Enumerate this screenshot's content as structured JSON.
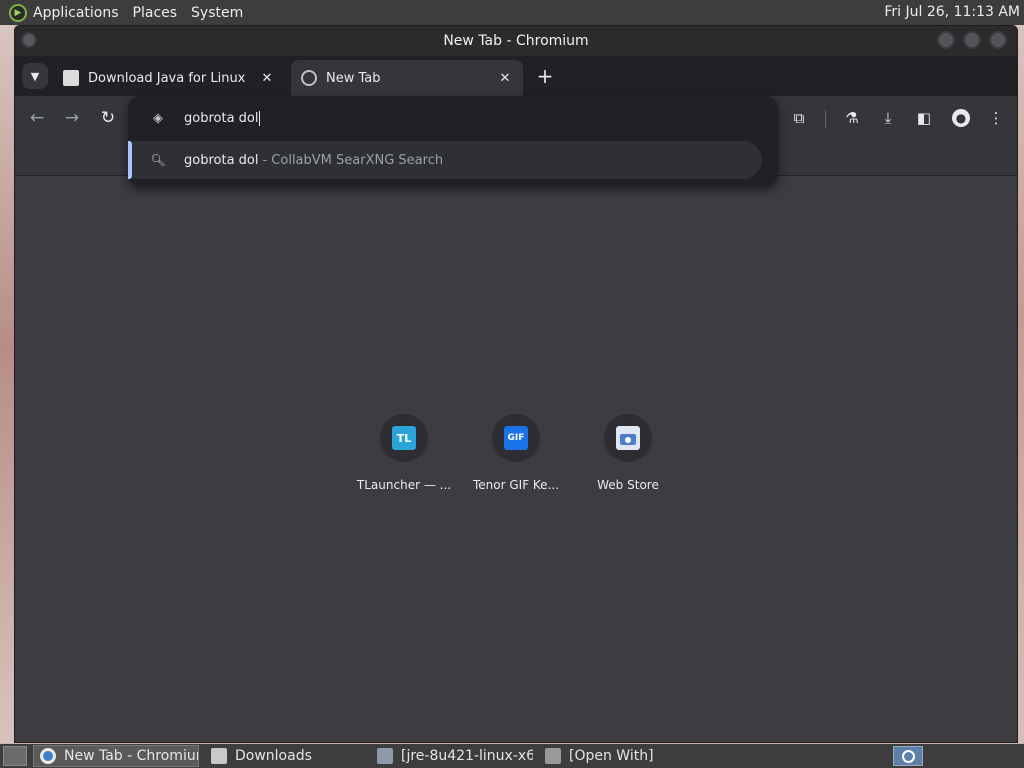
{
  "panel": {
    "menus": [
      "Applications",
      "Places",
      "System"
    ],
    "clock": "Fri Jul 26, 11:13 AM"
  },
  "window": {
    "title": "New Tab - Chromium"
  },
  "tabs": [
    {
      "label": "Download Java for Linux",
      "icon": "document-icon"
    },
    {
      "label": "New Tab",
      "icon": "globe-icon",
      "active": true
    }
  ],
  "omnibox": {
    "text": "gobrota dol",
    "suggestion": {
      "query": "gobrota dol",
      "source": "- CollabVM SearXNG Search"
    }
  },
  "shortcuts": [
    {
      "title": "TLauncher — ...",
      "icon_text": "TL",
      "color": "#2aa5d8"
    },
    {
      "title": "Tenor GIF Ke...",
      "icon_text": "GIF",
      "color": "#1a73e8"
    },
    {
      "title": "Web Store",
      "icon_text": "",
      "color": "#4f7ec9"
    }
  ],
  "taskbar": {
    "items": [
      {
        "label": "New Tab - Chromium",
        "icon": "chromium-icon",
        "active": true
      },
      {
        "label": "Downloads",
        "icon": "folder-icon"
      },
      {
        "label": "[jre-8u421-linux-x6...",
        "icon": "archive-icon"
      },
      {
        "label": "[Open With]",
        "icon": "dialog-icon"
      }
    ]
  },
  "colors": {
    "tab_strip": "#202124",
    "toolbar": "#35363a",
    "content": "#3c3c41",
    "accent": "#a8c7fa"
  }
}
